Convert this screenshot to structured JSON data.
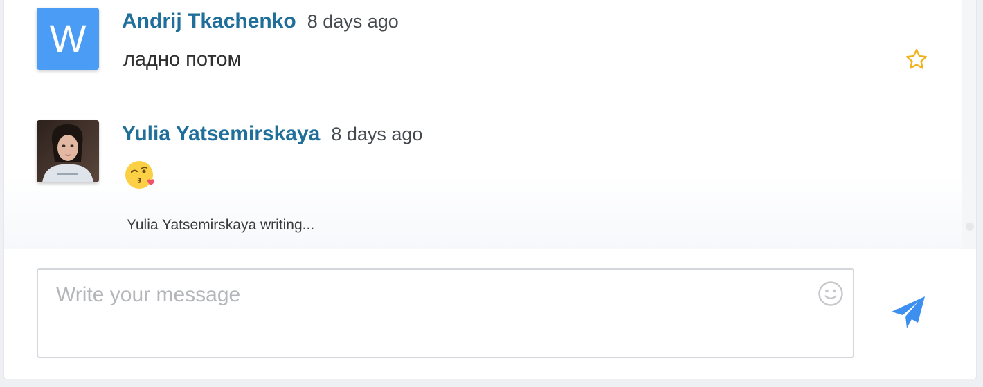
{
  "messages": [
    {
      "author": "Andrij Tkachenko",
      "time": "8 days ago",
      "text": "ладно потом",
      "avatar_letter": "W",
      "avatar_color": "#4a9cf5",
      "starred": false
    },
    {
      "author": "Yulia Yatsemirskaya",
      "time": "8 days ago",
      "emoji": "face-blowing-kiss",
      "avatar": "user-photo"
    }
  ],
  "typing_indicator": "Yulia Yatsemirskaya writing...",
  "composer": {
    "placeholder": "Write your message",
    "value": "",
    "emoji_icon": "smiley-icon",
    "send_icon": "paper-plane-icon"
  },
  "colors": {
    "author": "#1f6f9a",
    "star": "#f2b21b",
    "send": "#3d8ff0",
    "avatar_blue": "#4a9cf5"
  }
}
